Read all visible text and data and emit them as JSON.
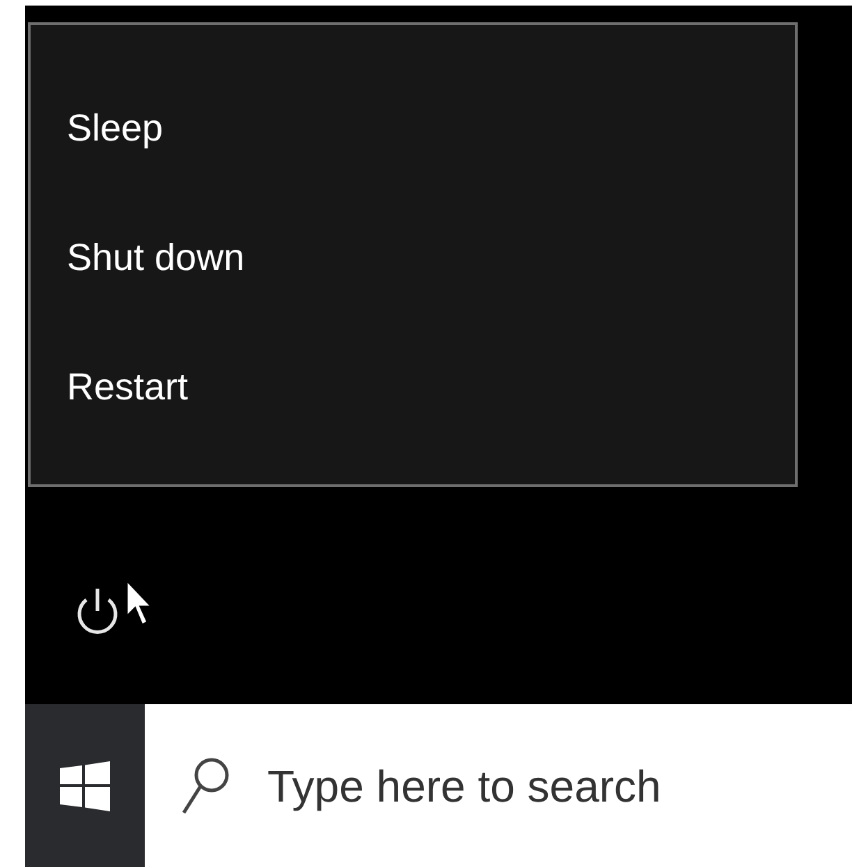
{
  "power_menu": {
    "items": [
      {
        "label": "Sleep"
      },
      {
        "label": "Shut down"
      },
      {
        "label": "Restart"
      }
    ]
  },
  "taskbar": {
    "search": {
      "placeholder": "Type here to search"
    }
  }
}
